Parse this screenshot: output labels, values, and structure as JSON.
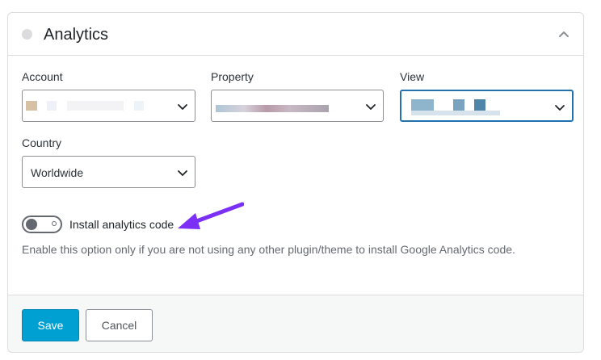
{
  "panel": {
    "title": "Analytics"
  },
  "fields": {
    "account": {
      "label": "Account",
      "value": ""
    },
    "property": {
      "label": "Property",
      "value": ""
    },
    "view": {
      "label": "View",
      "value": ""
    },
    "country": {
      "label": "Country",
      "value": "Worldwide"
    }
  },
  "toggle": {
    "label": "Install analytics code",
    "enabled": false,
    "help": "Enable this option only if you are not using any other plugin/theme to install Google Analytics code."
  },
  "footer": {
    "save_label": "Save",
    "cancel_label": "Cancel"
  },
  "icons": {
    "collapse": "chevron-up-icon",
    "select": "chevron-down-icon",
    "annotation": "arrow-icon"
  },
  "colors": {
    "primary": "#00a0d2",
    "focus": "#2271b1",
    "annotation": "#7b2ff7"
  }
}
